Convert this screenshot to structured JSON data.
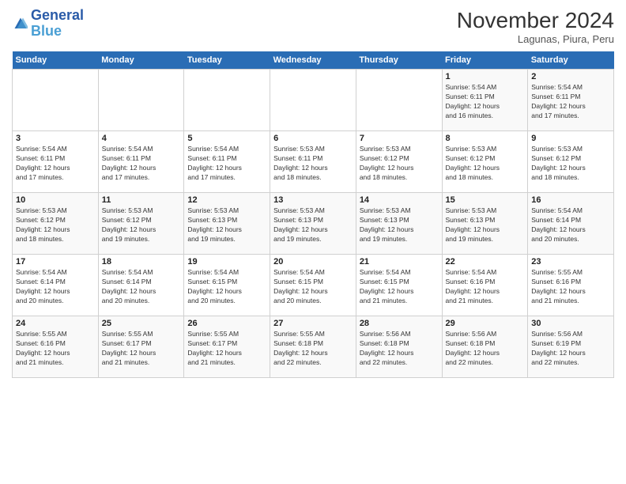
{
  "header": {
    "logo_line1": "General",
    "logo_line2": "Blue",
    "month": "November 2024",
    "location": "Lagunas, Piura, Peru"
  },
  "weekdays": [
    "Sunday",
    "Monday",
    "Tuesday",
    "Wednesday",
    "Thursday",
    "Friday",
    "Saturday"
  ],
  "weeks": [
    [
      {
        "day": "",
        "info": ""
      },
      {
        "day": "",
        "info": ""
      },
      {
        "day": "",
        "info": ""
      },
      {
        "day": "",
        "info": ""
      },
      {
        "day": "",
        "info": ""
      },
      {
        "day": "1",
        "info": "Sunrise: 5:54 AM\nSunset: 6:11 PM\nDaylight: 12 hours\nand 16 minutes."
      },
      {
        "day": "2",
        "info": "Sunrise: 5:54 AM\nSunset: 6:11 PM\nDaylight: 12 hours\nand 17 minutes."
      }
    ],
    [
      {
        "day": "3",
        "info": "Sunrise: 5:54 AM\nSunset: 6:11 PM\nDaylight: 12 hours\nand 17 minutes."
      },
      {
        "day": "4",
        "info": "Sunrise: 5:54 AM\nSunset: 6:11 PM\nDaylight: 12 hours\nand 17 minutes."
      },
      {
        "day": "5",
        "info": "Sunrise: 5:54 AM\nSunset: 6:11 PM\nDaylight: 12 hours\nand 17 minutes."
      },
      {
        "day": "6",
        "info": "Sunrise: 5:53 AM\nSunset: 6:11 PM\nDaylight: 12 hours\nand 18 minutes."
      },
      {
        "day": "7",
        "info": "Sunrise: 5:53 AM\nSunset: 6:12 PM\nDaylight: 12 hours\nand 18 minutes."
      },
      {
        "day": "8",
        "info": "Sunrise: 5:53 AM\nSunset: 6:12 PM\nDaylight: 12 hours\nand 18 minutes."
      },
      {
        "day": "9",
        "info": "Sunrise: 5:53 AM\nSunset: 6:12 PM\nDaylight: 12 hours\nand 18 minutes."
      }
    ],
    [
      {
        "day": "10",
        "info": "Sunrise: 5:53 AM\nSunset: 6:12 PM\nDaylight: 12 hours\nand 18 minutes."
      },
      {
        "day": "11",
        "info": "Sunrise: 5:53 AM\nSunset: 6:12 PM\nDaylight: 12 hours\nand 19 minutes."
      },
      {
        "day": "12",
        "info": "Sunrise: 5:53 AM\nSunset: 6:13 PM\nDaylight: 12 hours\nand 19 minutes."
      },
      {
        "day": "13",
        "info": "Sunrise: 5:53 AM\nSunset: 6:13 PM\nDaylight: 12 hours\nand 19 minutes."
      },
      {
        "day": "14",
        "info": "Sunrise: 5:53 AM\nSunset: 6:13 PM\nDaylight: 12 hours\nand 19 minutes."
      },
      {
        "day": "15",
        "info": "Sunrise: 5:53 AM\nSunset: 6:13 PM\nDaylight: 12 hours\nand 19 minutes."
      },
      {
        "day": "16",
        "info": "Sunrise: 5:54 AM\nSunset: 6:14 PM\nDaylight: 12 hours\nand 20 minutes."
      }
    ],
    [
      {
        "day": "17",
        "info": "Sunrise: 5:54 AM\nSunset: 6:14 PM\nDaylight: 12 hours\nand 20 minutes."
      },
      {
        "day": "18",
        "info": "Sunrise: 5:54 AM\nSunset: 6:14 PM\nDaylight: 12 hours\nand 20 minutes."
      },
      {
        "day": "19",
        "info": "Sunrise: 5:54 AM\nSunset: 6:15 PM\nDaylight: 12 hours\nand 20 minutes."
      },
      {
        "day": "20",
        "info": "Sunrise: 5:54 AM\nSunset: 6:15 PM\nDaylight: 12 hours\nand 20 minutes."
      },
      {
        "day": "21",
        "info": "Sunrise: 5:54 AM\nSunset: 6:15 PM\nDaylight: 12 hours\nand 21 minutes."
      },
      {
        "day": "22",
        "info": "Sunrise: 5:54 AM\nSunset: 6:16 PM\nDaylight: 12 hours\nand 21 minutes."
      },
      {
        "day": "23",
        "info": "Sunrise: 5:55 AM\nSunset: 6:16 PM\nDaylight: 12 hours\nand 21 minutes."
      }
    ],
    [
      {
        "day": "24",
        "info": "Sunrise: 5:55 AM\nSunset: 6:16 PM\nDaylight: 12 hours\nand 21 minutes."
      },
      {
        "day": "25",
        "info": "Sunrise: 5:55 AM\nSunset: 6:17 PM\nDaylight: 12 hours\nand 21 minutes."
      },
      {
        "day": "26",
        "info": "Sunrise: 5:55 AM\nSunset: 6:17 PM\nDaylight: 12 hours\nand 21 minutes."
      },
      {
        "day": "27",
        "info": "Sunrise: 5:55 AM\nSunset: 6:18 PM\nDaylight: 12 hours\nand 22 minutes."
      },
      {
        "day": "28",
        "info": "Sunrise: 5:56 AM\nSunset: 6:18 PM\nDaylight: 12 hours\nand 22 minutes."
      },
      {
        "day": "29",
        "info": "Sunrise: 5:56 AM\nSunset: 6:18 PM\nDaylight: 12 hours\nand 22 minutes."
      },
      {
        "day": "30",
        "info": "Sunrise: 5:56 AM\nSunset: 6:19 PM\nDaylight: 12 hours\nand 22 minutes."
      }
    ]
  ]
}
